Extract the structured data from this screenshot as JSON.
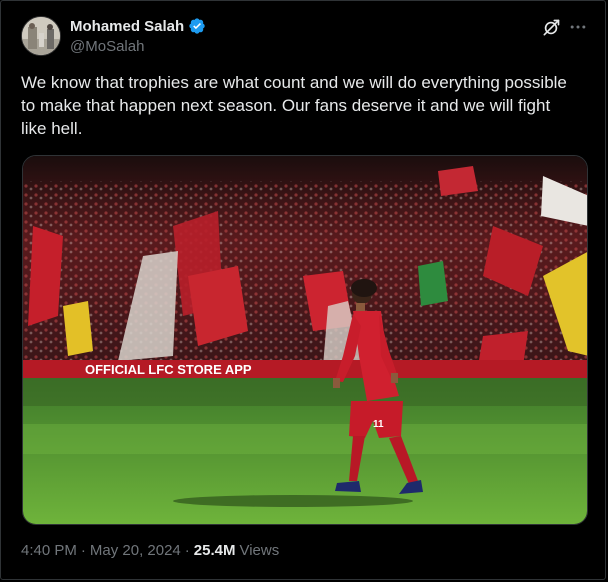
{
  "author": {
    "name": "Mohamed Salah",
    "handle": "@MoSalah",
    "verified": true
  },
  "tweet": {
    "text": "We know that trophies are what count and we will do everything possible\nto make that happen next season. Our fans deserve it and we will fight\nlike hell."
  },
  "media": {
    "banner_text": "OFFICIAL LFC STORE APP",
    "shirt_number": "11"
  },
  "meta": {
    "time": "4:40 PM",
    "sep1": "·",
    "date": "May 20, 2024",
    "sep2": "·",
    "views_count": "25.4M",
    "views_label": "Views"
  },
  "colors": {
    "background": "#000000",
    "text": "#e7e9ea",
    "muted": "#71767b",
    "verified": "#1d9bf0",
    "border": "#2f3336"
  },
  "icons": [
    "verified-badge-icon",
    "grok-icon",
    "more-icon"
  ]
}
